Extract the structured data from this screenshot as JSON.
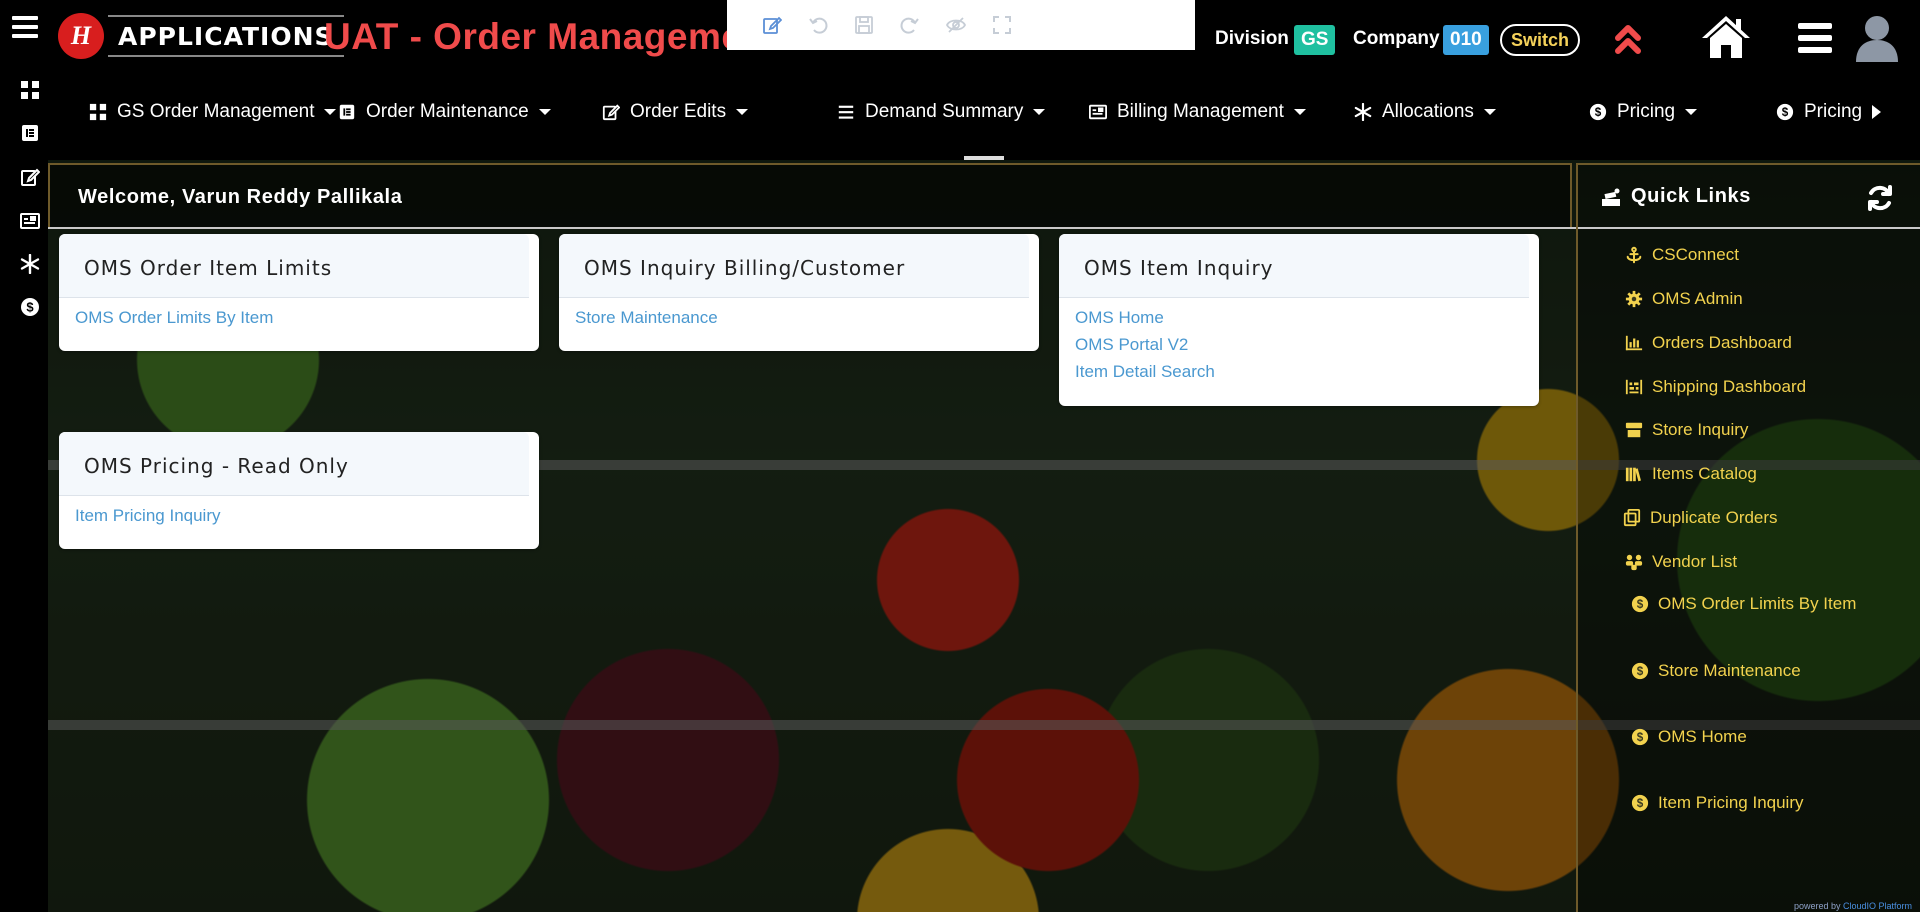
{
  "header": {
    "logo_text": "APPLICATIONS",
    "title": "UAT - Order Management",
    "division_label": "Division",
    "division_value": "GS",
    "company_label": "Company",
    "company_value": "010",
    "switch_label": "Switch"
  },
  "editor_toolbar": [
    "edit-icon",
    "undo-icon",
    "save-icon",
    "redo-icon",
    "hide-icon",
    "fullscreen-icon"
  ],
  "nav": {
    "items": [
      {
        "label": "GS Order Management",
        "icon": "grid-icon"
      },
      {
        "label": "Order Maintenance",
        "icon": "document-icon"
      },
      {
        "label": "Order Edits",
        "icon": "edit-icon"
      },
      {
        "label": "Demand Summary",
        "icon": "list-icon"
      },
      {
        "label": "Billing Management",
        "icon": "id-card-icon"
      },
      {
        "label": "Allocations",
        "icon": "asterisk-icon"
      },
      {
        "label": "Pricing",
        "icon": "dollar-icon"
      },
      {
        "label": "Pricing",
        "icon": "dollar-icon"
      }
    ]
  },
  "welcome": "Welcome, Varun Reddy Pallikala",
  "cards": [
    {
      "title": "OMS Order Item Limits",
      "links": [
        "OMS Order Limits By Item"
      ]
    },
    {
      "title": "OMS Inquiry Billing/Customer",
      "links": [
        "Store Maintenance"
      ]
    },
    {
      "title": "OMS Item Inquiry",
      "links": [
        "OMS Home",
        "OMS Portal V2",
        "Item Detail Search"
      ]
    },
    {
      "title": "OMS Pricing - Read Only",
      "links": [
        "Item Pricing Inquiry"
      ]
    }
  ],
  "quick_links": {
    "title": "Quick Links",
    "items": [
      {
        "label": "CSConnect",
        "icon": "anchor-icon"
      },
      {
        "label": "OMS Admin",
        "icon": "gear-icon"
      },
      {
        "label": "Orders Dashboard",
        "icon": "bar-chart-icon"
      },
      {
        "label": "Shipping Dashboard",
        "icon": "barcode-icon"
      },
      {
        "label": "Store Inquiry",
        "icon": "store-icon"
      },
      {
        "label": "Items Catalog",
        "icon": "books-icon"
      },
      {
        "label": "Duplicate Orders",
        "icon": "copy-icon"
      },
      {
        "label": "Vendor List",
        "icon": "people-icon"
      },
      {
        "label": "OMS Order Limits By Item",
        "icon": "dollar-icon"
      },
      {
        "label": "Store Maintenance",
        "icon": "dollar-icon"
      },
      {
        "label": "OMS Home",
        "icon": "dollar-icon"
      },
      {
        "label": "Item Pricing Inquiry",
        "icon": "dollar-icon"
      }
    ]
  },
  "footer": {
    "prefix": "powered by ",
    "brand": "CloudIO Platform"
  },
  "colors": {
    "title_red": "#f04b4b",
    "link_blue": "#4a98d0",
    "quick_link_yellow": "#f2d24e",
    "division_badge": "#1fc0a0",
    "company_badge": "#39a0df"
  }
}
